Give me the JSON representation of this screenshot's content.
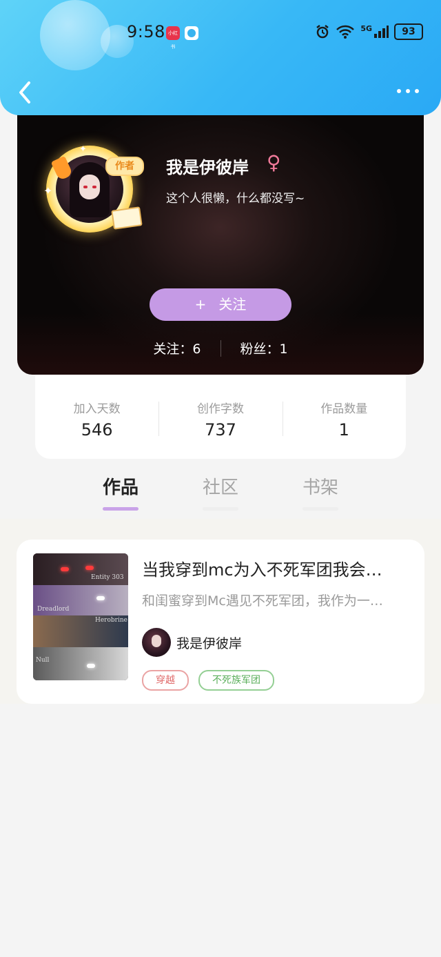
{
  "status_bar": {
    "time": "9:58",
    "app1_label": "小红书",
    "network": "5G",
    "battery": "93"
  },
  "header": {
    "back_icon": "back-chevron-icon",
    "more_icon": "more-dots-icon"
  },
  "profile": {
    "name": "我是伊彼岸",
    "gender_symbol": "♀",
    "bio": "这个人很懒，什么都没写~",
    "author_badge": "作者",
    "follow_button": "关注",
    "follow_plus": "+",
    "following_label": "关注：6",
    "followers_label": "粉丝：1"
  },
  "stats": [
    {
      "label": "加入天数",
      "value": "546"
    },
    {
      "label": "创作字数",
      "value": "737"
    },
    {
      "label": "作品数量",
      "value": "1"
    }
  ],
  "tabs": [
    {
      "label": "作品",
      "active": true
    },
    {
      "label": "社区",
      "active": false
    },
    {
      "label": "书架",
      "active": false
    }
  ],
  "works": [
    {
      "title": "当我穿到mc为入不死军团我会…",
      "description": "和闺蜜穿到Mc遇见不死军团，我作为一…",
      "author": "我是伊彼岸",
      "cover_labels": [
        "Entity 303",
        "Dreadlord",
        "Herobrine",
        "Null"
      ],
      "tags": [
        "穿越",
        "不死族军团"
      ]
    }
  ],
  "colors": {
    "header": "#38b8f6",
    "accent_purple": "#c59ae5",
    "tag_red": "#e06a6a",
    "tag_green": "#5aae5a"
  }
}
